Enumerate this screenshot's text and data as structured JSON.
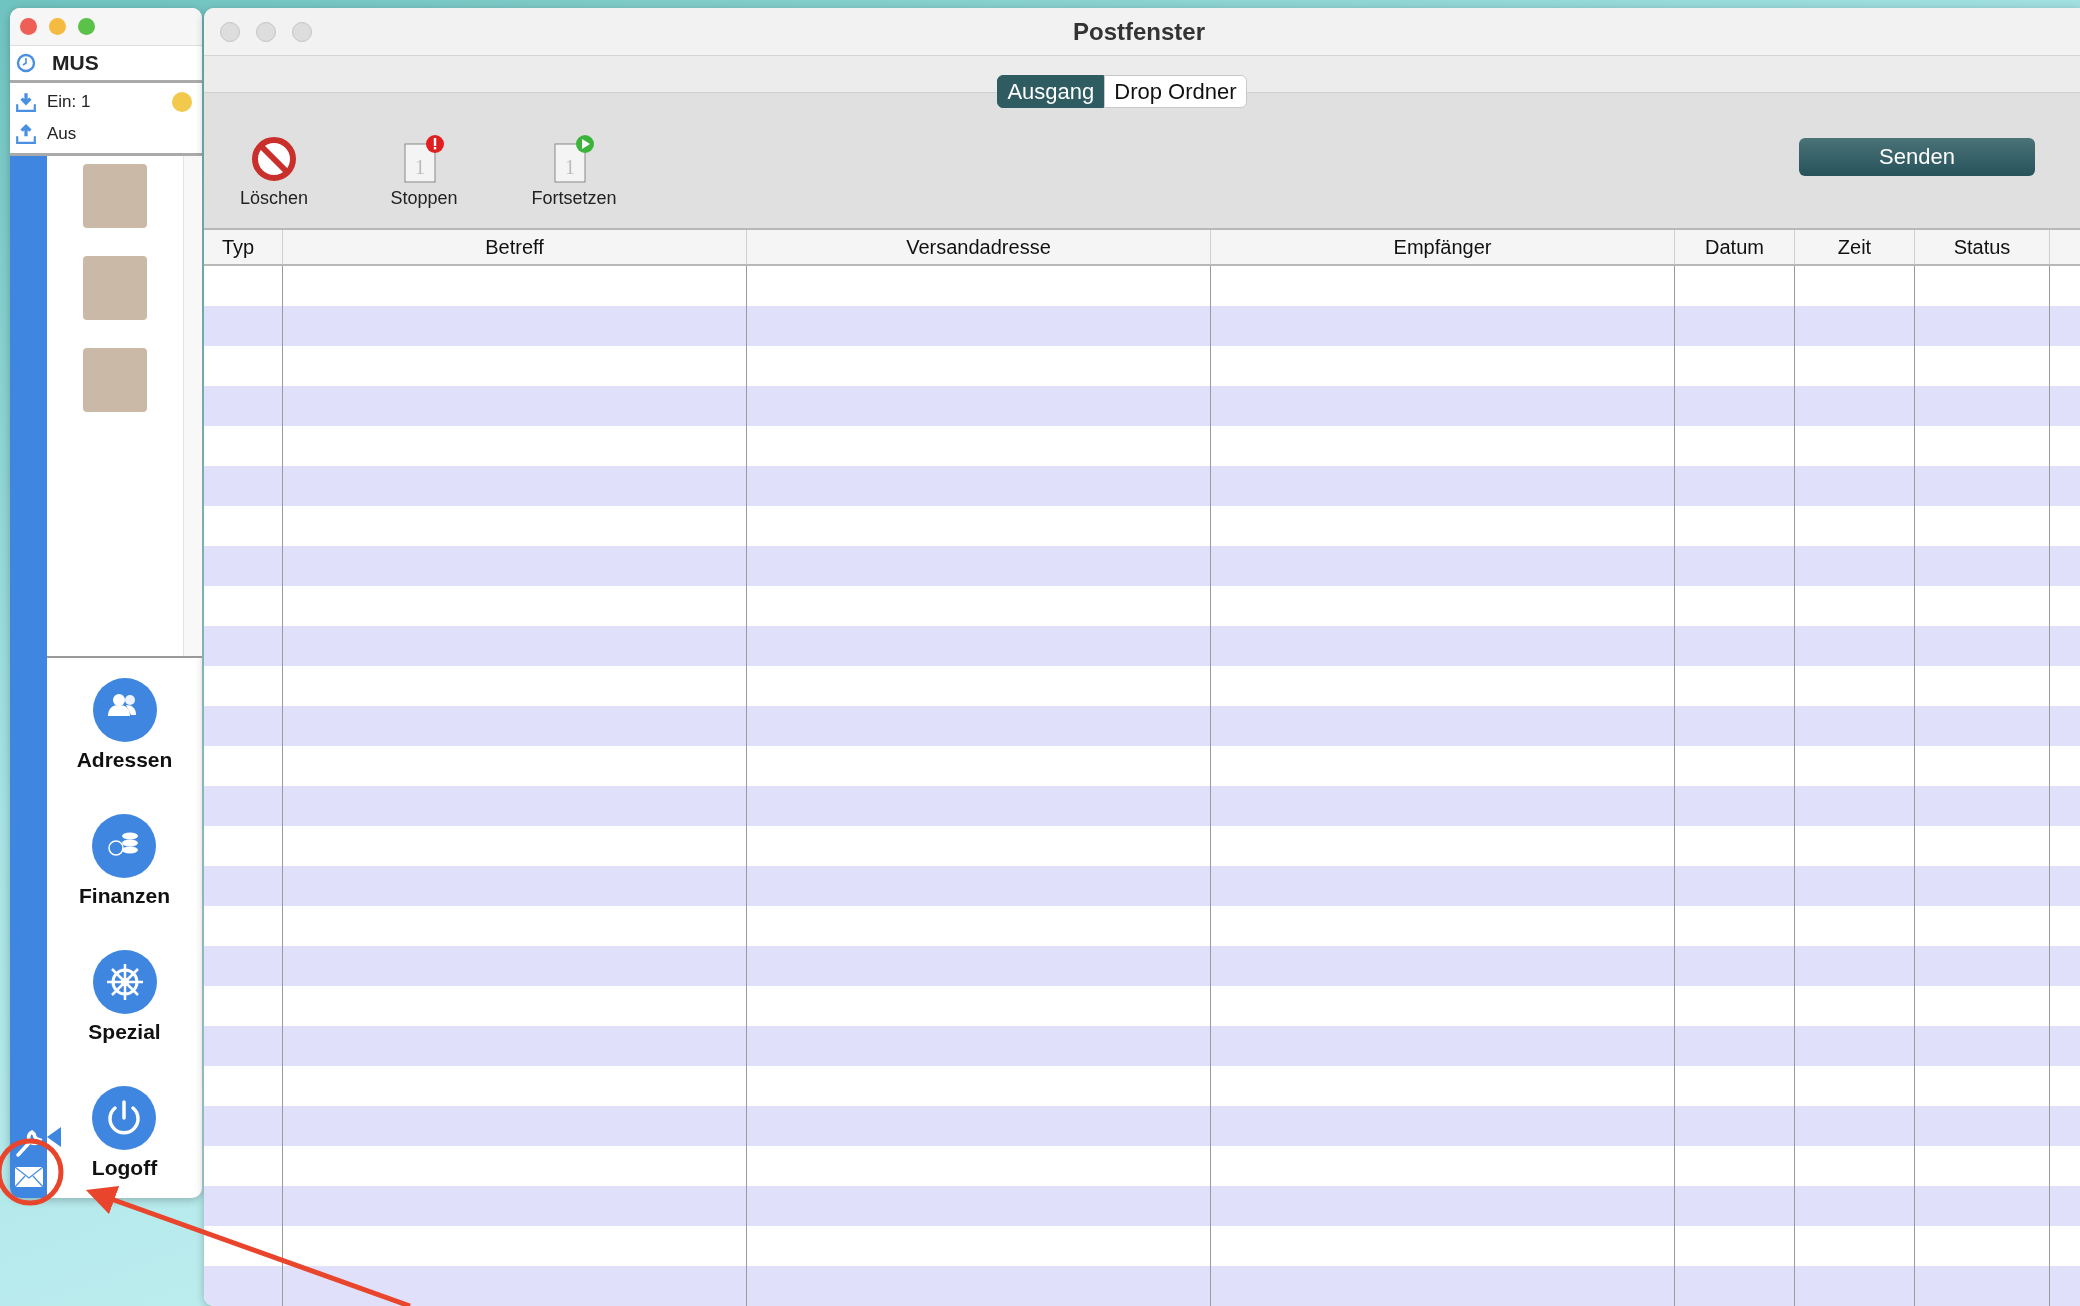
{
  "sidebar": {
    "user": "MUS",
    "mailboxes": [
      {
        "kind": "in",
        "label": "Ein: 1",
        "color": "#f2c94c"
      },
      {
        "kind": "out",
        "label": "Aus"
      }
    ],
    "nav": [
      {
        "kind": "people",
        "label": "Adressen"
      },
      {
        "kind": "coins",
        "label": "Finanzen"
      },
      {
        "kind": "wheel",
        "label": "Spezial"
      },
      {
        "kind": "power",
        "label": "Logoff"
      }
    ]
  },
  "window": {
    "title": "Postfenster"
  },
  "tabs": [
    {
      "label": "Ausgang",
      "selected": true
    },
    {
      "label": "Drop Ordner",
      "selected": false
    }
  ],
  "toolbar": [
    {
      "kind": "delete",
      "label": "Löschen"
    },
    {
      "kind": "stop",
      "label": "Stoppen",
      "count": "1"
    },
    {
      "kind": "resume",
      "label": "Fortsetzen",
      "count": "1"
    }
  ],
  "send_button": "Senden",
  "table": {
    "columns": [
      "Typ",
      "Betreff",
      "Versandadresse",
      "Empfänger",
      "Datum",
      "Zeit",
      "Status"
    ]
  }
}
